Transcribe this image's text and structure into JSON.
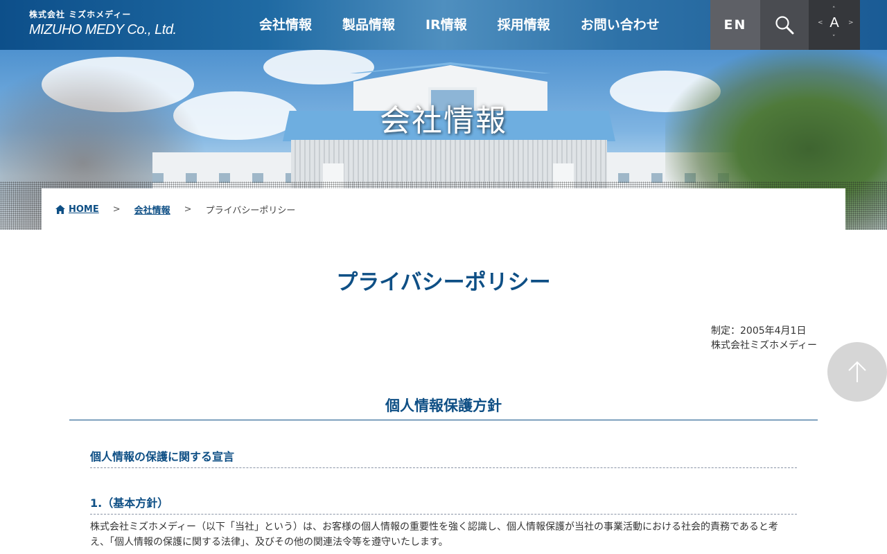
{
  "header": {
    "logo_jp": "株式会社 ミズホメディー",
    "logo_en": "MIZUHO MEDY Co., Ltd.",
    "nav": [
      {
        "label": "会社情報"
      },
      {
        "label": "製品情報"
      },
      {
        "label": "IR情報"
      },
      {
        "label": "採用情報"
      },
      {
        "label": "お問い合わせ"
      }
    ],
    "lang_label": "EN",
    "font_size_label": "A",
    "icons": {
      "search": "search-icon",
      "font_size": "font-size-icon"
    }
  },
  "hero": {
    "title": "会社情報"
  },
  "breadcrumb": {
    "home": "HOME",
    "separator": ">",
    "parent": "会社情報",
    "current": "プライバシーポリシー"
  },
  "content": {
    "page_title": "プライバシーポリシー",
    "enacted": "制定：2005年4月1日",
    "company": "株式会社ミズホメディー",
    "section_title": "個人情報保護方針",
    "subsection_title": "個人情報の保護に関する宣言",
    "article_title": "1.（基本方針）",
    "article_text": "株式会社ミズホメディー（以下「当社」という）は、お客様の個人情報の重要性を強く認識し、個人情報保護が当社の事業活動における社会的責務であると考え、「個人情報の保護に関する法律」、及びその他の関連法令等を遵守いたします。"
  },
  "colors": {
    "brand_blue": "#0e4f85",
    "header_gradient_start": "#0d4f8a",
    "to_top_button": "#d6d6d6"
  }
}
